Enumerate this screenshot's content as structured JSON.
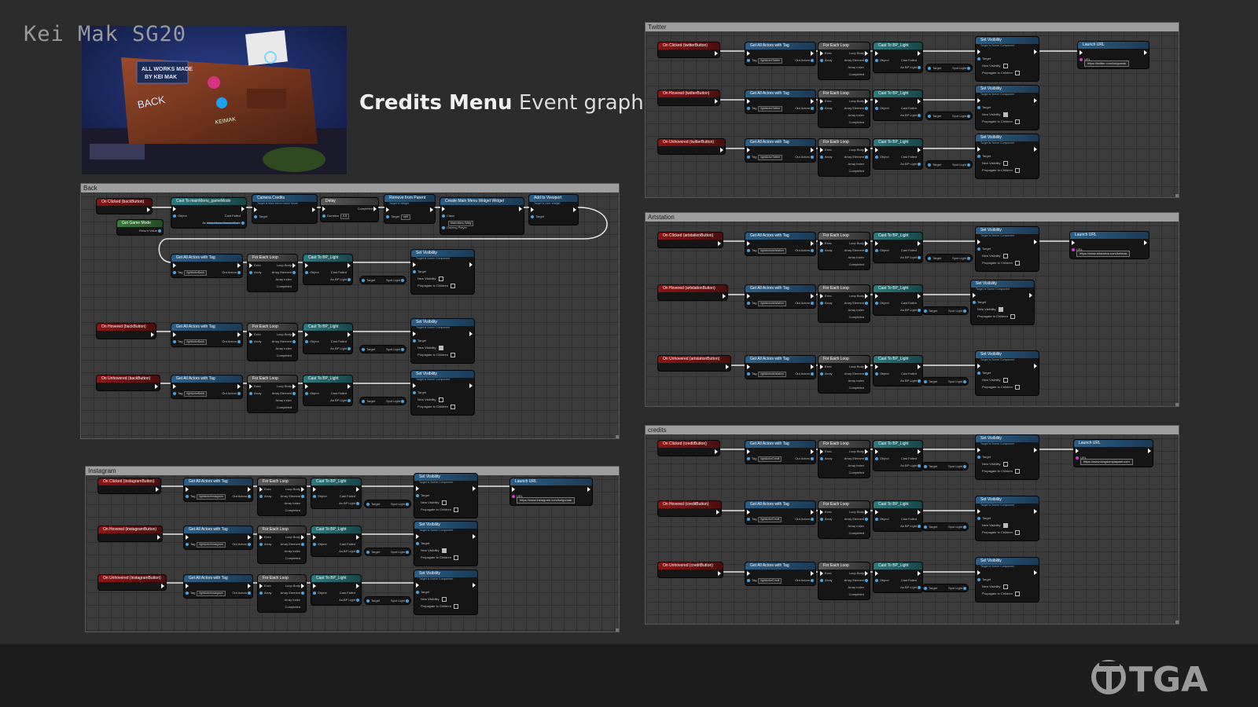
{
  "header": {
    "title_bold": "Credits Menu",
    "title_rest": "Event graph"
  },
  "hero_image": {
    "sign_line1": "ALL WORKS MADE",
    "sign_line2": "BY KEI MAK",
    "sign_back": "BACK",
    "sign_credits": "KEIMAK"
  },
  "footer": {
    "author": "Kei Mak SG20",
    "logo_text": "TGA"
  },
  "common": {
    "get_actors": "Get All Actors with Tag",
    "tag_label": "Tag",
    "out_actors": "Out Actors",
    "for_each": "For Each Loop",
    "exec": "Exec",
    "loop_body": "Loop Body",
    "array": "Array",
    "array_element": "Array Element",
    "array_index": "Array Index",
    "completed": "Completed",
    "cast": "Cast To BP_Light",
    "object": "Object",
    "cast_failed": "Cast Failed",
    "as_bp_light": "As BP Light",
    "target": "Target",
    "spot_light": "Spot Light",
    "set_visibility": "Set Visibility",
    "target_is_scene": "Target is Scene Component",
    "new_visibility": "New Visibility",
    "propagate": "Propagate to Children",
    "launch_url": "Launch URL",
    "url_label": "URL"
  },
  "panels": {
    "back": {
      "title": "Back",
      "clicked": "On Clicked (backButton)",
      "hovered": "On Hovered (backButton)",
      "unhovered": "On Unhovered (backButton)",
      "tag": "lightActorBack",
      "cast_main": "Cast To mainMenu_gameMode",
      "object": "Object",
      "cast_failed": "Cast Failed",
      "as_main": "As Main Menu Game Mode",
      "get_game_mode": "Get Game Mode",
      "return_value": "Return Value",
      "camera_credits": "Camera Credits",
      "camera_sub": "Target is Main Menu Game Mode",
      "target": "Target",
      "delay": "Delay",
      "duration": "Duration",
      "duration_val": "0.5",
      "completed": "Completed",
      "remove_parent": "Remove from Parent",
      "remove_sub": "Target is Widget",
      "self": "self",
      "create_widget": "Create Main Menu Widget Widget",
      "class": "Class",
      "class_val": "Main Menu Widg",
      "owning_player": "Owning Player",
      "add_viewport": "Add to Viewport",
      "add_sub": "Target is User Widget"
    },
    "instagram": {
      "title": "Instagram",
      "clicked": "On Clicked (instagramButton)",
      "hovered": "On Hovered (instagramButton)",
      "unhovered": "On Unhovered (instagramButton)",
      "tag": "lightActorInstagram",
      "url": "https://www.instagram.com/keigomak"
    },
    "twitter": {
      "title": "Twitter",
      "clicked": "On Clicked (twitterButton)",
      "hovered": "On Hovered (twitterButton)",
      "unhovered": "On Unhovered (twitterButton)",
      "tag": "lightActorTwitter",
      "url": "https://twitter.com/keigomak"
    },
    "artstation": {
      "title": "Artstation",
      "clicked": "On Clicked (artstationButton)",
      "hovered": "On Hovered (artstationButton)",
      "unhovered": "On Unhovered (artstationButton)",
      "tag": "lightActorArtstation",
      "url": "https://www.artstation.com/keimak"
    },
    "credits": {
      "title": "credits",
      "clicked": "On Clicked (creditButton)",
      "hovered": "On Hovered (creditButton)",
      "unhovered": "On Unhovered (creditButton)",
      "tag": "lightActorCredit",
      "url": "https://www.kingdomplaywel.com"
    }
  }
}
